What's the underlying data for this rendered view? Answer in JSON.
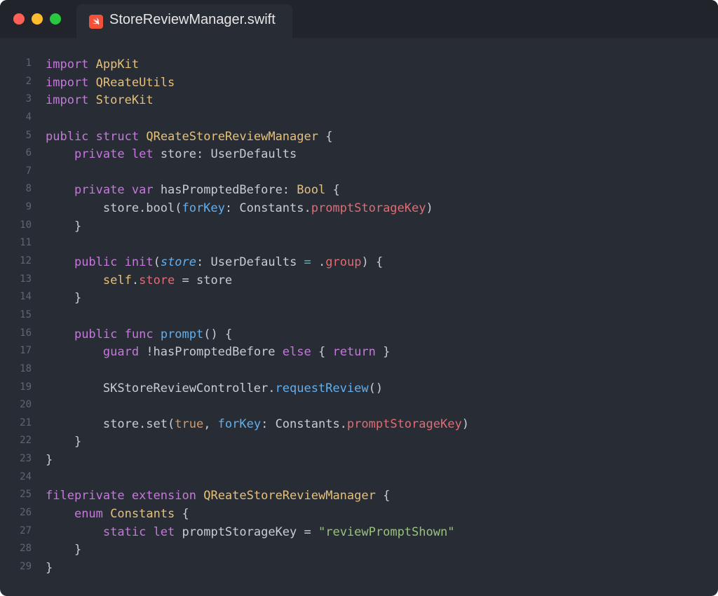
{
  "window": {
    "tab_title": "StoreReviewManager.swift",
    "tab_icon": "swift-icon",
    "colors": {
      "background": "#282c34",
      "titlebar": "#21252b",
      "close": "#ff5f57",
      "minimize": "#febc2e",
      "maximize": "#28c840"
    }
  },
  "code": {
    "lines": [
      [
        {
          "t": "import",
          "c": "kw"
        },
        {
          "t": " "
        },
        {
          "t": "AppKit",
          "c": "type"
        }
      ],
      [
        {
          "t": "import",
          "c": "kw"
        },
        {
          "t": " "
        },
        {
          "t": "QReateUtils",
          "c": "type"
        }
      ],
      [
        {
          "t": "import",
          "c": "kw"
        },
        {
          "t": " "
        },
        {
          "t": "StoreKit",
          "c": "type"
        }
      ],
      [],
      [
        {
          "t": "public",
          "c": "kw"
        },
        {
          "t": " "
        },
        {
          "t": "struct",
          "c": "kw"
        },
        {
          "t": " "
        },
        {
          "t": "QReateStoreReviewManager",
          "c": "type"
        },
        {
          "t": " {"
        }
      ],
      [
        {
          "t": "    "
        },
        {
          "t": "private",
          "c": "kw"
        },
        {
          "t": " "
        },
        {
          "t": "let",
          "c": "kw"
        },
        {
          "t": " store: UserDefaults"
        }
      ],
      [],
      [
        {
          "t": "    "
        },
        {
          "t": "private",
          "c": "kw"
        },
        {
          "t": " "
        },
        {
          "t": "var",
          "c": "kw"
        },
        {
          "t": " hasPromptedBefore: "
        },
        {
          "t": "Bool",
          "c": "type"
        },
        {
          "t": " {"
        }
      ],
      [
        {
          "t": "        store.bool("
        },
        {
          "t": "forKey",
          "c": "fn"
        },
        {
          "t": ": Constants."
        },
        {
          "t": "promptStorageKey",
          "c": "prop"
        },
        {
          "t": ")"
        }
      ],
      [
        {
          "t": "    }"
        }
      ],
      [],
      [
        {
          "t": "    "
        },
        {
          "t": "public",
          "c": "kw"
        },
        {
          "t": " "
        },
        {
          "t": "init",
          "c": "kw"
        },
        {
          "t": "("
        },
        {
          "t": "store",
          "c": "param"
        },
        {
          "t": ": UserDefaults "
        },
        {
          "t": "=",
          "c": "op"
        },
        {
          "t": " ."
        },
        {
          "t": "group",
          "c": "prop"
        },
        {
          "t": ") {"
        }
      ],
      [
        {
          "t": "        "
        },
        {
          "t": "self",
          "c": "type"
        },
        {
          "t": "."
        },
        {
          "t": "store",
          "c": "prop"
        },
        {
          "t": " = store"
        }
      ],
      [
        {
          "t": "    }"
        }
      ],
      [],
      [
        {
          "t": "    "
        },
        {
          "t": "public",
          "c": "kw"
        },
        {
          "t": " "
        },
        {
          "t": "func",
          "c": "kw"
        },
        {
          "t": " "
        },
        {
          "t": "prompt",
          "c": "fn"
        },
        {
          "t": "() {"
        }
      ],
      [
        {
          "t": "        "
        },
        {
          "t": "guard",
          "c": "kw"
        },
        {
          "t": " !hasPromptedBefore "
        },
        {
          "t": "else",
          "c": "kw"
        },
        {
          "t": " { "
        },
        {
          "t": "return",
          "c": "kw"
        },
        {
          "t": " }"
        }
      ],
      [],
      [
        {
          "t": "        SKStoreReviewController."
        },
        {
          "t": "requestReview",
          "c": "fn"
        },
        {
          "t": "()"
        }
      ],
      [],
      [
        {
          "t": "        store.set("
        },
        {
          "t": "true",
          "c": "num"
        },
        {
          "t": ", "
        },
        {
          "t": "forKey",
          "c": "fn"
        },
        {
          "t": ": Constants."
        },
        {
          "t": "promptStorageKey",
          "c": "prop"
        },
        {
          "t": ")"
        }
      ],
      [
        {
          "t": "    }"
        }
      ],
      [
        {
          "t": "}"
        }
      ],
      [],
      [
        {
          "t": "fileprivate",
          "c": "kw"
        },
        {
          "t": " "
        },
        {
          "t": "extension",
          "c": "kw"
        },
        {
          "t": " "
        },
        {
          "t": "QReateStoreReviewManager",
          "c": "type"
        },
        {
          "t": " {"
        }
      ],
      [
        {
          "t": "    "
        },
        {
          "t": "enum",
          "c": "kw"
        },
        {
          "t": " "
        },
        {
          "t": "Constants",
          "c": "type"
        },
        {
          "t": " {"
        }
      ],
      [
        {
          "t": "        "
        },
        {
          "t": "static",
          "c": "kw"
        },
        {
          "t": " "
        },
        {
          "t": "let",
          "c": "kw"
        },
        {
          "t": " promptStorageKey = "
        },
        {
          "t": "\"reviewPromptShown\"",
          "c": "str"
        }
      ],
      [
        {
          "t": "    }"
        }
      ],
      [
        {
          "t": "}"
        }
      ]
    ]
  }
}
